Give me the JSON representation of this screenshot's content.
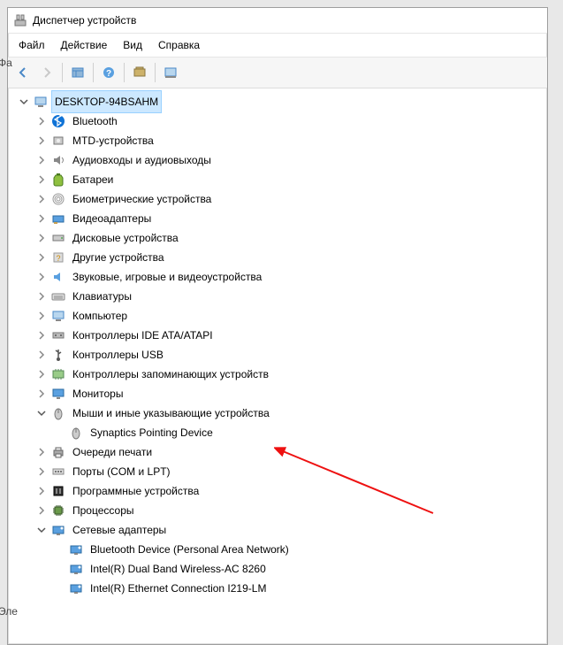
{
  "window": {
    "title": "Диспетчер устройств"
  },
  "menu": [
    "Файл",
    "Действие",
    "Вид",
    "Справка"
  ],
  "bg_fragments": [
    "Фа",
    "Эле"
  ],
  "root": {
    "label": "DESKTOP-94BSAHM",
    "expanded": true,
    "selected": true,
    "icon": "computer",
    "children": [
      {
        "label": "Bluetooth",
        "icon": "bluetooth",
        "expandable": true
      },
      {
        "label": "MTD-устройства",
        "icon": "disk",
        "expandable": true
      },
      {
        "label": "Аудиовходы и аудиовыходы",
        "icon": "speaker",
        "expandable": true
      },
      {
        "label": "Батареи",
        "icon": "battery",
        "expandable": true
      },
      {
        "label": "Биометрические устройства",
        "icon": "fingerprint",
        "expandable": true
      },
      {
        "label": "Видеоадаптеры",
        "icon": "display-card",
        "expandable": true
      },
      {
        "label": "Дисковые устройства",
        "icon": "hdd",
        "expandable": true
      },
      {
        "label": "Другие устройства",
        "icon": "unknown",
        "expandable": true
      },
      {
        "label": "Звуковые, игровые и видеоустройства",
        "icon": "sound",
        "expandable": true
      },
      {
        "label": "Клавиатуры",
        "icon": "keyboard",
        "expandable": true
      },
      {
        "label": "Компьютер",
        "icon": "computer",
        "expandable": true
      },
      {
        "label": "Контроллеры IDE ATA/ATAPI",
        "icon": "ide",
        "expandable": true
      },
      {
        "label": "Контроллеры USB",
        "icon": "usb",
        "expandable": true
      },
      {
        "label": "Контроллеры запоминающих устройств",
        "icon": "storage-ctrl",
        "expandable": true
      },
      {
        "label": "Мониторы",
        "icon": "monitor",
        "expandable": true
      },
      {
        "label": "Мыши и иные указывающие устройства",
        "icon": "mouse",
        "expandable": true,
        "expanded": true,
        "children": [
          {
            "label": "Synaptics Pointing Device",
            "icon": "mouse",
            "expandable": false
          }
        ]
      },
      {
        "label": "Очереди печати",
        "icon": "printer",
        "expandable": true
      },
      {
        "label": "Порты (COM и LPT)",
        "icon": "port",
        "expandable": true
      },
      {
        "label": "Программные устройства",
        "icon": "software",
        "expandable": true
      },
      {
        "label": "Процессоры",
        "icon": "cpu",
        "expandable": true
      },
      {
        "label": "Сетевые адаптеры",
        "icon": "network",
        "expandable": true,
        "expanded": true,
        "children": [
          {
            "label": "Bluetooth Device (Personal Area Network)",
            "icon": "network",
            "expandable": false
          },
          {
            "label": "Intel(R) Dual Band Wireless-AC 8260",
            "icon": "network",
            "expandable": false
          },
          {
            "label": "Intel(R) Ethernet Connection I219-LM",
            "icon": "network",
            "expandable": false
          }
        ]
      }
    ]
  }
}
